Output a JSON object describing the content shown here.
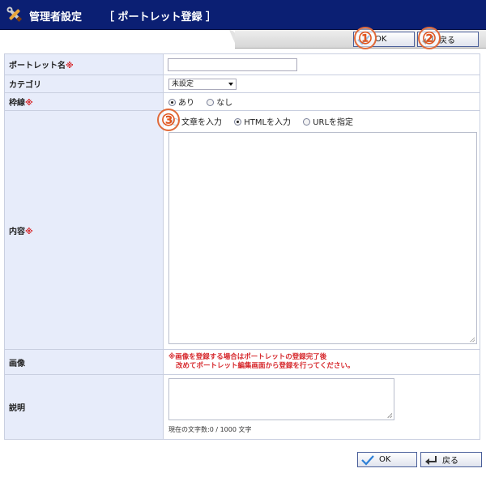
{
  "header": {
    "title": "管理者設定",
    "subtitle": "［ ポートレット登録 ］",
    "icon": "tools-icon"
  },
  "toolbar": {
    "ok_label": "OK",
    "back_label": "戻る",
    "badges": [
      "①",
      "②",
      "③"
    ]
  },
  "form": {
    "name_label": "ポートレット名",
    "required_mark": "※",
    "name_value": "",
    "category_label": "カテゴリ",
    "category_value": "未設定",
    "border_label": "枠線",
    "border_options": [
      "あり",
      "なし"
    ],
    "border_selected": "あり",
    "content_label": "内容",
    "content_options": [
      "文章を入力",
      "HTMLを入力",
      "URLを指定"
    ],
    "content_selected": "HTMLを入力",
    "content_value": "",
    "image_label": "画像",
    "image_note_line1": "※画像を登録する場合はポートレットの登録完了後",
    "image_note_line2": "改めてポートレット編集画面から登録を行ってください。",
    "desc_label": "説明",
    "desc_value": "",
    "char_count": "現在の文字数:0 / 1000 文字"
  },
  "colors": {
    "header_bg": "#0b1f73",
    "label_bg": "#e7ecfa",
    "required": "#d6282c",
    "badge": "#e0551f"
  }
}
